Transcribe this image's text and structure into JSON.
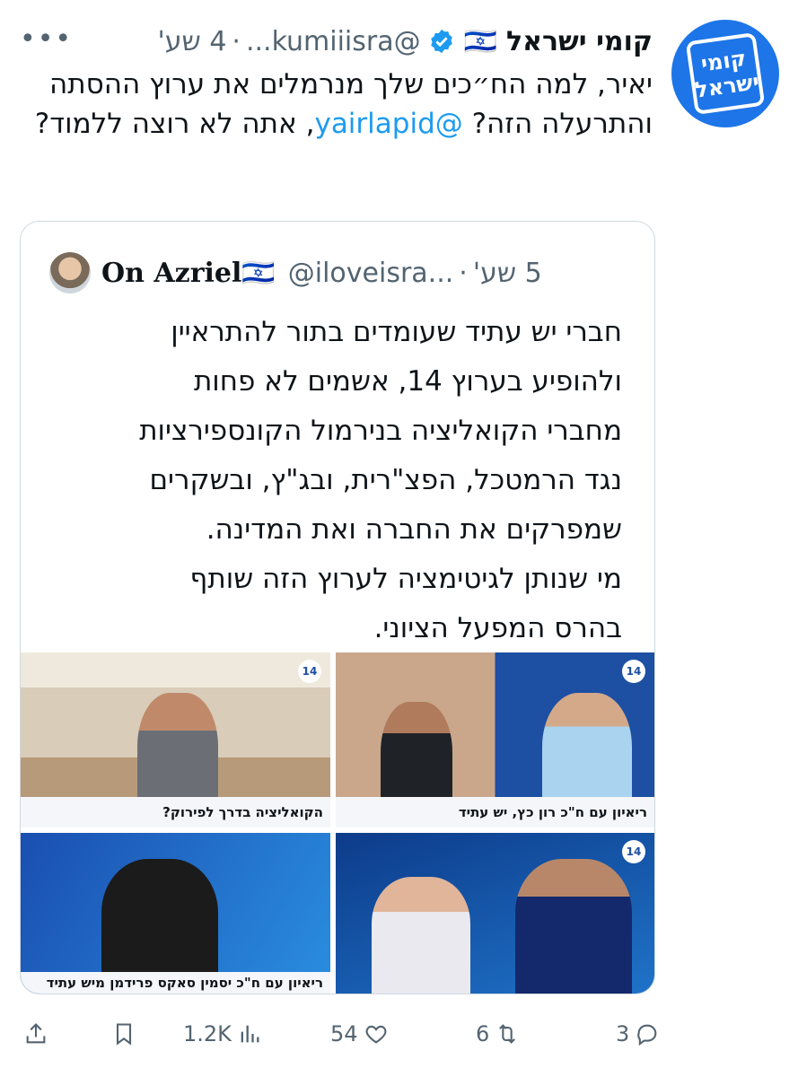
{
  "tweet": {
    "display_name": "קומי ישראל",
    "flag": "🇮🇱",
    "handle": "@kumiiisra...",
    "separator": "·",
    "time": "4 שע'",
    "text_before_mention": "יאיר, למה הח״כים שלך מנרמלים את ערוץ ההסתה והתרעלה הזה? ",
    "mention": "@yairlapid",
    "text_after_mention": ", אתה לא רוצה ללמוד?",
    "avatar_logo": [
      "קומי",
      "ישראל"
    ]
  },
  "quoted": {
    "display_name": "On Azriel",
    "flag": "🇮🇱",
    "handle": "@iloveisra...",
    "separator": "·",
    "time": "5 שע'",
    "text": "חברי יש עתיד שעומדים בתור להתראיין\nולהופיע בערוץ 14, אשמים לא פחות\nמחברי הקואליציה בנירמול הקונספירציות\nנגד הרמטכל, הפצ\"רית, ובג\"ץ, ובשקרים\nשמפרקים את החברה ואת המדינה.\nמי שנותן לגיטימציה לערוץ הזה שותף\nבהרס המפעל הציוני.",
    "media_captions": {
      "top_left": "הקואליציה בדרך לפירוק?",
      "top_right": "ריאיון עם ח\"כ רון כץ, יש עתיד",
      "bottom_left": "ריאיון עם ח\"כ יסמין סאקס פרידמן מיש עתיד",
      "bottom_right": ""
    },
    "channel_badge": "14"
  },
  "actions": {
    "views": "1.2K",
    "likes": "54",
    "retweets": "6",
    "replies": "3"
  },
  "colors": {
    "accent": "#1d9bf0",
    "muted": "#536471",
    "logo_bg": "#1d75e8"
  }
}
